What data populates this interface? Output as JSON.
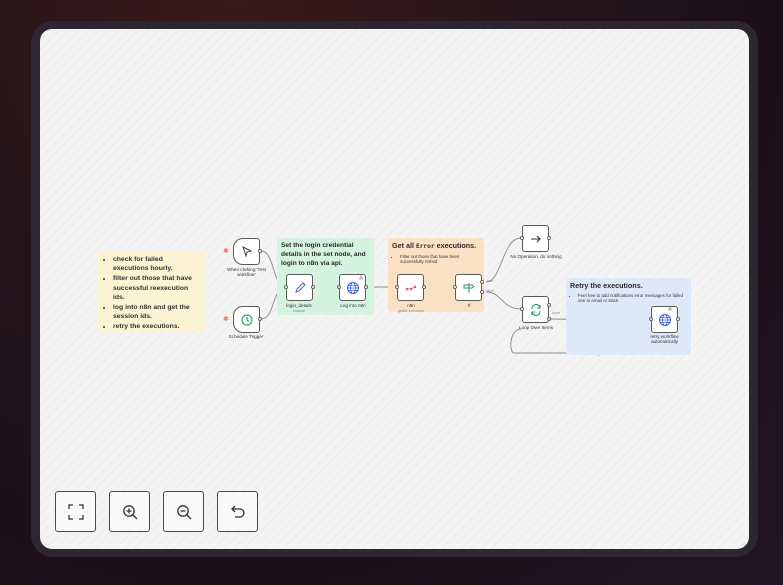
{
  "stickies": {
    "main": {
      "items": [
        "check for failed executions hourly.",
        "filter out those that have successful reexecution ids.",
        "log into n8n and get the session ids.",
        "retry the executions."
      ]
    },
    "login": {
      "title": "Set the login credential details in the set node, and login to n8n via api."
    },
    "errors": {
      "title_pre": "Get all",
      "title_code": "Error",
      "title_post": "executions.",
      "items": [
        "Filter out those that have been successfully retried"
      ]
    },
    "retry": {
      "title": "Retry the executions.",
      "items": [
        "Feel free to add notifications error messages for failed one to email or slack"
      ]
    }
  },
  "nodes": {
    "manual_trigger": {
      "label": "When clicking 'Test workflow'",
      "icon": "cursor-icon"
    },
    "schedule_trigger": {
      "label": "Schedule Trigger",
      "icon": "clock-icon"
    },
    "login_details": {
      "label": "login_details",
      "sub": "manual",
      "icon": "pencil-icon"
    },
    "log_into": {
      "label": "Log into n8n",
      "icon": "globe-icon"
    },
    "n8n": {
      "label": "n8n",
      "sub": "getAll: execution",
      "icon": "n8n-icon"
    },
    "if": {
      "label": "If",
      "icon": "signpost-icon",
      "true_label": "true",
      "false_label": "false"
    },
    "no_op": {
      "label": "No Operation, do nothing",
      "icon": "arrow-right-icon"
    },
    "loop": {
      "label": "Loop Over Items",
      "icon": "loop-icon",
      "done_label": "done",
      "loop_label": "loop"
    },
    "retry": {
      "label": "retry workflow automatically",
      "icon": "globe-icon"
    }
  },
  "controls": {
    "fit": "fit-view-icon",
    "zoom_in": "zoom-in-icon",
    "zoom_out": "zoom-out-icon",
    "reset": "undo-icon"
  }
}
